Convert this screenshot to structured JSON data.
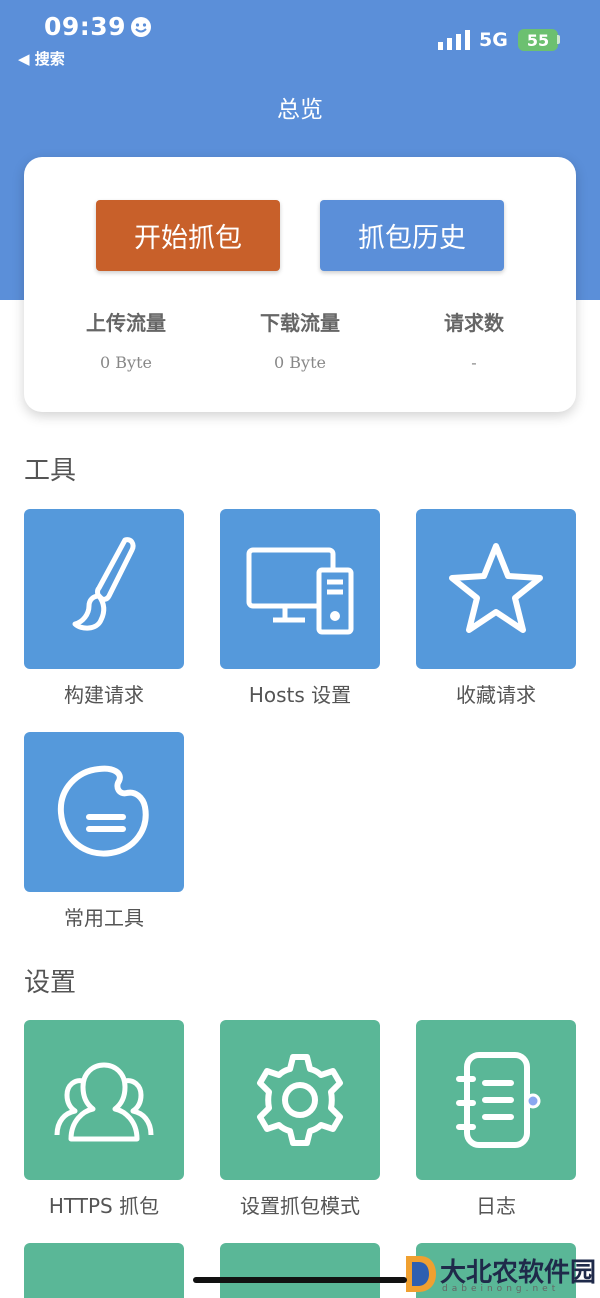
{
  "status_bar": {
    "time": "09:39",
    "back_label": "◀ 搜索",
    "network": "5G",
    "battery": "55"
  },
  "page": {
    "title": "总览"
  },
  "overview": {
    "start_button": "开始抓包",
    "history_button": "抓包历史",
    "stats": [
      {
        "label": "上传流量",
        "value": "0 Byte"
      },
      {
        "label": "下载流量",
        "value": "0 Byte"
      },
      {
        "label": "请求数",
        "value": "-"
      }
    ]
  },
  "tools": {
    "title": "工具",
    "items": [
      {
        "label": "构建请求",
        "icon": "paintbrush-icon"
      },
      {
        "label": "Hosts 设置",
        "icon": "desktop-computer-icon"
      },
      {
        "label": "收藏请求",
        "icon": "star-icon"
      },
      {
        "label": "常用工具",
        "icon": "palette-icon"
      }
    ]
  },
  "settings": {
    "title": "设置",
    "items": [
      {
        "label": "HTTPS 抓包",
        "icon": "users-icon"
      },
      {
        "label": "设置抓包模式",
        "icon": "gear-icon"
      },
      {
        "label": "日志",
        "icon": "notebook-icon"
      }
    ]
  },
  "watermark": {
    "text": "大北农软件园",
    "sub": "dabeinong.net"
  },
  "colors": {
    "header": "#5b8fd9",
    "start_button": "#c8602a",
    "tool_tile": "#5599db",
    "settings_tile": "#5ab797"
  }
}
